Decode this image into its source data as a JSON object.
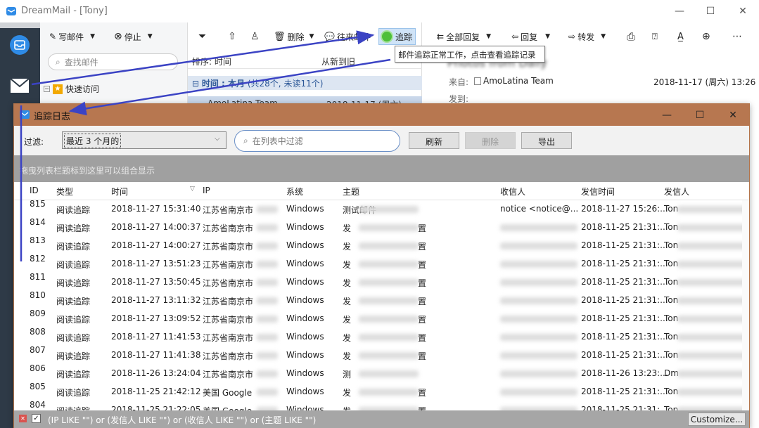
{
  "app": {
    "title": "DreamMail - [Tony]",
    "window_controls": {
      "minimize": "—",
      "maximize": "☐",
      "close": "✕"
    }
  },
  "toolbar": {
    "compose_label": "写邮件",
    "stop_label": "停止",
    "delete_label": "删除",
    "contacts_label": "往来邮件",
    "track_label": "追踪",
    "reply_all_label": "全部回复",
    "reply_label": "回复",
    "forward_label": "转发"
  },
  "nav": {
    "search_placeholder": "查找邮件",
    "quick_access_label": "快速访问"
  },
  "list": {
    "sort_label": "排序: 时间",
    "sort_order": "从新到旧",
    "group_label": "时间 : 本月",
    "group_count": "(共28个, 未读11个)",
    "selected_sender": "AmoLatina Team",
    "selected_date": "2018-11-17 (周六)"
  },
  "tooltip": "邮件追踪正常工作，点击查看追踪记录",
  "reading": {
    "subject": "Photos from Daily",
    "from_label": "来自:",
    "from_value": "AmoLatina Team",
    "date": "2018-11-17 (周六) 13:26",
    "to_label": "发到:"
  },
  "dialog": {
    "title": "追踪日志",
    "filter_label": "过滤:",
    "filter_value": "最近 3 个月的",
    "search_placeholder": "在列表中过滤",
    "refresh_label": "刷新",
    "delete_label": "删除",
    "export_label": "导出",
    "group_hint": "拖曳列表栏题标到这里可以组合显示",
    "columns": [
      "ID",
      "类型",
      "时间",
      "IP",
      "系统",
      "主题",
      "收信人",
      "发信时间",
      "发信人"
    ],
    "rows": [
      {
        "id": "815",
        "type": "阅读追踪",
        "time": "2018-11-27 15:31:40",
        "ip": "江苏省南京市",
        "os": "Windows",
        "subject": "测试邮件",
        "subject_tail": "",
        "to": "notice <notice@...",
        "sent": "2018-11-27 15:26:...",
        "from": "Ton"
      },
      {
        "id": "814",
        "type": "阅读追踪",
        "time": "2018-11-27 14:00:37",
        "ip": "江苏省南京市",
        "os": "Windows",
        "subject": "发",
        "subject_tail": "置",
        "to": "",
        "sent": "2018-11-25 21:31:...",
        "from": "Ton"
      },
      {
        "id": "813",
        "type": "阅读追踪",
        "time": "2018-11-27 14:00:27",
        "ip": "江苏省南京市",
        "os": "Windows",
        "subject": "发",
        "subject_tail": "置",
        "to": "",
        "sent": "2018-11-25 21:31:...",
        "from": "Ton"
      },
      {
        "id": "812",
        "type": "阅读追踪",
        "time": "2018-11-27 13:51:23",
        "ip": "江苏省南京市",
        "os": "Windows",
        "subject": "发",
        "subject_tail": "置",
        "to": "",
        "sent": "2018-11-25 21:31:...",
        "from": "Ton"
      },
      {
        "id": "811",
        "type": "阅读追踪",
        "time": "2018-11-27 13:50:45",
        "ip": "江苏省南京市",
        "os": "Windows",
        "subject": "发",
        "subject_tail": "置",
        "to": "",
        "sent": "2018-11-25 21:31:...",
        "from": "Ton"
      },
      {
        "id": "810",
        "type": "阅读追踪",
        "time": "2018-11-27 13:11:32",
        "ip": "江苏省南京市",
        "os": "Windows",
        "subject": "发",
        "subject_tail": "置",
        "to": "",
        "sent": "2018-11-25 21:31:...",
        "from": "Ton"
      },
      {
        "id": "809",
        "type": "阅读追踪",
        "time": "2018-11-27 13:09:52",
        "ip": "江苏省南京市",
        "os": "Windows",
        "subject": "发",
        "subject_tail": "置",
        "to": "",
        "sent": "2018-11-25 21:31:...",
        "from": "Ton"
      },
      {
        "id": "808",
        "type": "阅读追踪",
        "time": "2018-11-27 11:41:53",
        "ip": "江苏省南京市",
        "os": "Windows",
        "subject": "发",
        "subject_tail": "置",
        "to": "",
        "sent": "2018-11-25 21:31:...",
        "from": "Ton"
      },
      {
        "id": "807",
        "type": "阅读追踪",
        "time": "2018-11-27 11:41:38",
        "ip": "江苏省南京市",
        "os": "Windows",
        "subject": "发",
        "subject_tail": "置",
        "to": "",
        "sent": "2018-11-25 21:31:...",
        "from": "Ton"
      },
      {
        "id": "806",
        "type": "阅读追踪",
        "time": "2018-11-26 13:24:04",
        "ip": "江苏省南京市",
        "os": "Windows",
        "subject": "测",
        "subject_tail": "",
        "to": "",
        "sent": "2018-11-26 13:23:...",
        "from": "Dm"
      },
      {
        "id": "805",
        "type": "阅读追踪",
        "time": "2018-11-25 21:42:12",
        "ip": "美国 Google",
        "os": "Windows",
        "subject": "发",
        "subject_tail": "置",
        "to": "",
        "sent": "2018-11-25 21:31:...",
        "from": "Ton"
      },
      {
        "id": "804",
        "type": "阅读追踪",
        "time": "2018-11-25 21:22:05",
        "ip": "美国 Google",
        "os": "Windows",
        "subject": "发",
        "subject_tail": "置",
        "to": "",
        "sent": "2018-11-25 21:31:...",
        "from": "Ton"
      }
    ],
    "status_filter": "(IP LIKE \"\") or (发信人 LIKE \"\") or (收信人 LIKE \"\") or (主题 LIKE \"\")",
    "customize_label": "Customize..."
  },
  "colors": {
    "dialog_title_bg": "#b77750",
    "rail_bg": "#2e3a47",
    "arrow": "#3b43c4",
    "highlight": "#cfe3f7"
  }
}
